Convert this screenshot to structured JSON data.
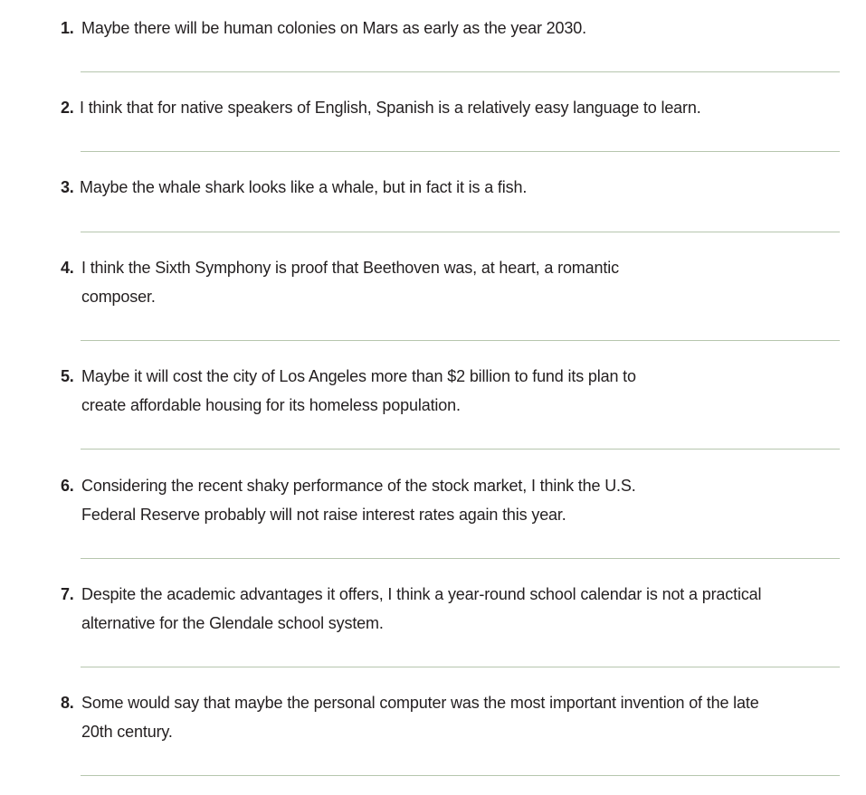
{
  "items": [
    {
      "number": "1.",
      "text": "Maybe there will be human colonies on Mars as early as the year 2030."
    },
    {
      "number": "2.",
      "text": "I think that for native speakers of English, Spanish is a relatively easy language to learn."
    },
    {
      "number": "3.",
      "text": "Maybe the whale shark looks like a whale, but in fact it is a fish."
    },
    {
      "number": "4.",
      "text": "I think the Sixth Symphony is proof that Beethoven was, at heart, a romantic\ncomposer."
    },
    {
      "number": "5.",
      "text": "Maybe it will cost the city of Los Angeles more than $2 billion to fund its plan to\ncreate affordable housing for its homeless population."
    },
    {
      "number": "6.",
      "text": "Considering the recent shaky performance of the stock market, I think the U.S.\nFederal Reserve probably will not raise interest rates again this year."
    },
    {
      "number": "7.",
      "text": "Despite the academic advantages it offers, I think a year-round school calendar is not a practical\nalternative for the Glendale school system."
    },
    {
      "number": "8.",
      "text": "Some would say that maybe the personal computer was the most important invention of the late\n20th century."
    }
  ]
}
